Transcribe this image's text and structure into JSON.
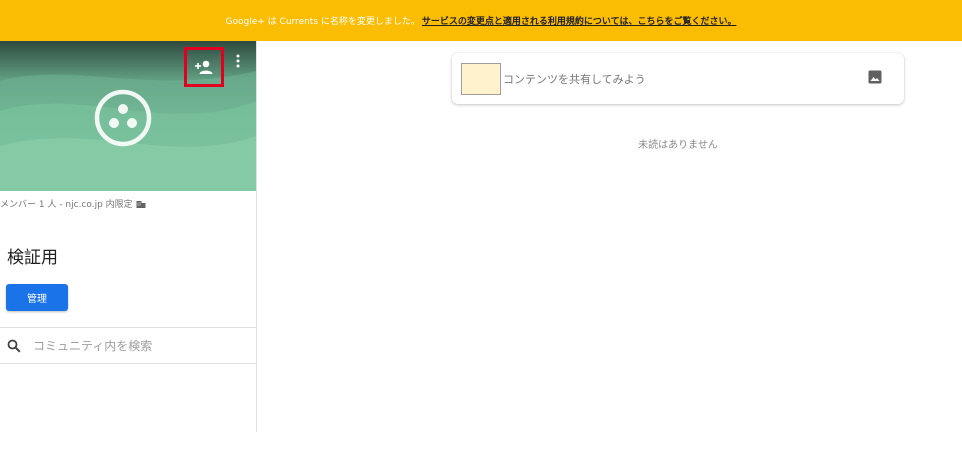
{
  "banner": {
    "text": "Google+ は Currents に名称を変更しました。",
    "link": "サービスの変更点と適用される利用規約については、こちらをご覧ください。",
    "color": "#fbbc04"
  },
  "sidebar": {
    "cover": {
      "add_member_icon": "person-add-icon",
      "more_icon": "more-vert-icon",
      "logo_icon": "community-icon"
    },
    "meta_text": "メンバー 1 人 - njc.co.jp 内限定",
    "meta_icon": "domain-building-icon",
    "title": "検証用",
    "manage_label": "管理",
    "search": {
      "icon": "search-icon",
      "placeholder": "コミュニティ内を検索"
    }
  },
  "compose": {
    "prompt": "コンテンツを共有してみよう",
    "image_icon": "image-icon"
  },
  "feed": {
    "empty_text": "未読はありません"
  },
  "colors": {
    "accent": "#1a73e8",
    "highlight": "#e1001f"
  }
}
